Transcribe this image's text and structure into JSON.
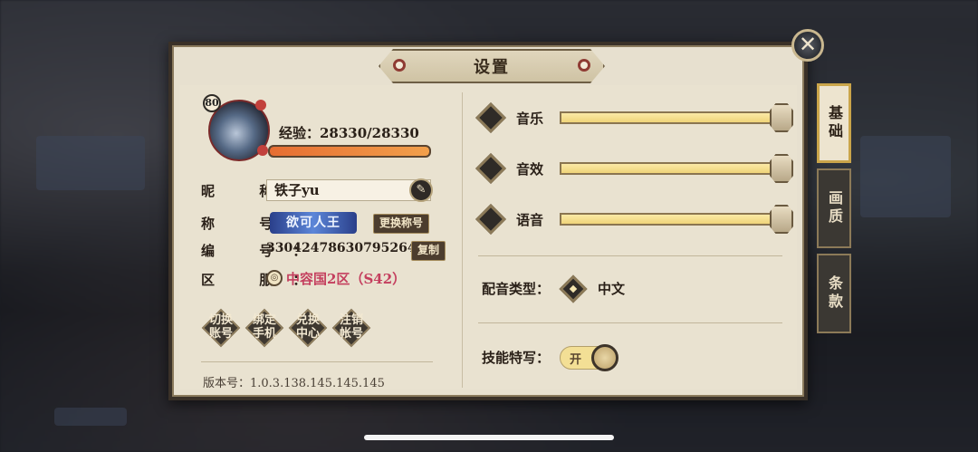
{
  "dialog": {
    "title": "设置",
    "close_label": "✕"
  },
  "profile": {
    "level": "80",
    "exp_label": "经验：28330/28330",
    "exp_fraction": 1.0,
    "nickname_label": "昵 称：",
    "nickname_value": "铁子yu",
    "title_label": "称 号：",
    "title_badge": "欲可人王",
    "change_title_btn": "更换称号",
    "id_label": "编 号：",
    "id_value": "3304247863079526400",
    "copy_btn": "复制",
    "server_label": "区 服：",
    "server_value": "中容国2区（S42）"
  },
  "actions": [
    {
      "line1": "切换",
      "line2": "账号"
    },
    {
      "line1": "绑定",
      "line2": "手机"
    },
    {
      "line1": "兑换",
      "line2": "中心"
    },
    {
      "line1": "注销",
      "line2": "帐号"
    }
  ],
  "version_text": "版本号：1.0.3.138.145.145.145",
  "audio": [
    {
      "label": "音乐",
      "level": 1.0
    },
    {
      "label": "音效",
      "level": 1.0
    },
    {
      "label": "语音",
      "level": 1.0
    }
  ],
  "voice_type": {
    "label": "配音类型：",
    "value": "中文"
  },
  "skill_closeup": {
    "label": "技能特写：",
    "state": "开"
  },
  "tabs": [
    {
      "label": "基础",
      "active": true
    },
    {
      "label": "画质",
      "active": false
    },
    {
      "label": "条款",
      "active": false
    }
  ],
  "colors": {
    "panel_bg": "#e7e0cf",
    "server_text": "#c43f5e",
    "slider_fill": "#f5e08e",
    "active_tab_border": "#caa54a"
  }
}
